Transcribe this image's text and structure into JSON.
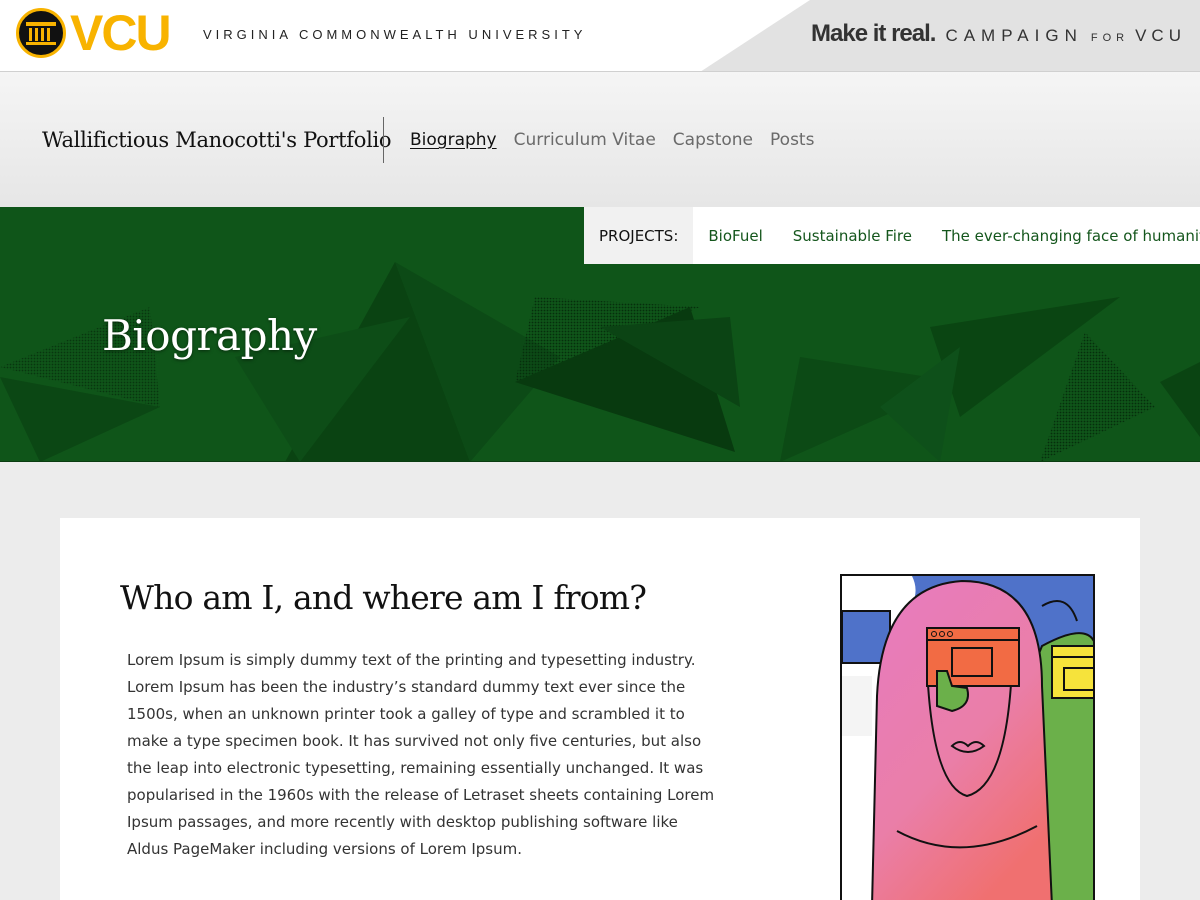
{
  "brand": {
    "logo_text": "VCU",
    "university_name": "VIRGINIA COMMONWEALTH UNIVERSITY",
    "campaign_tagline": "Make it real.",
    "campaign_word": "CAMPAIGN",
    "campaign_for": "FOR",
    "campaign_vcu": "VCU",
    "brand_color": "#f8b300"
  },
  "site": {
    "title": "Wallifictious Manocotti's Portfolio",
    "nav": [
      {
        "label": "Biography",
        "active": true
      },
      {
        "label": "Curriculum Vitae",
        "active": false
      },
      {
        "label": "Capstone",
        "active": false
      },
      {
        "label": "Posts",
        "active": false
      }
    ]
  },
  "projects": {
    "label": "PROJECTS:",
    "items": [
      "BioFuel",
      "Sustainable Fire",
      "The ever-changing face of humanity"
    ]
  },
  "hero": {
    "title": "Biography",
    "background_color": "#0f5519"
  },
  "content": {
    "heading": "Who am I, and where am I from?",
    "body": "Lorem Ipsum is simply dummy text of the printing and typesetting industry. Lorem Ipsum has been the industry’s standard dummy text ever since the 1500s, when an unknown printer took a galley of type and scrambled it to make a type specimen book. It has survived not only five centuries, but also the leap into electronic typesetting, remaining essentially unchanged. It was popularised in the 1960s with the release of Letraset sheets containing Lorem Ipsum passages, and more recently with desktop publishing software like Aldus PageMaker including versions of Lorem Ipsum."
  }
}
